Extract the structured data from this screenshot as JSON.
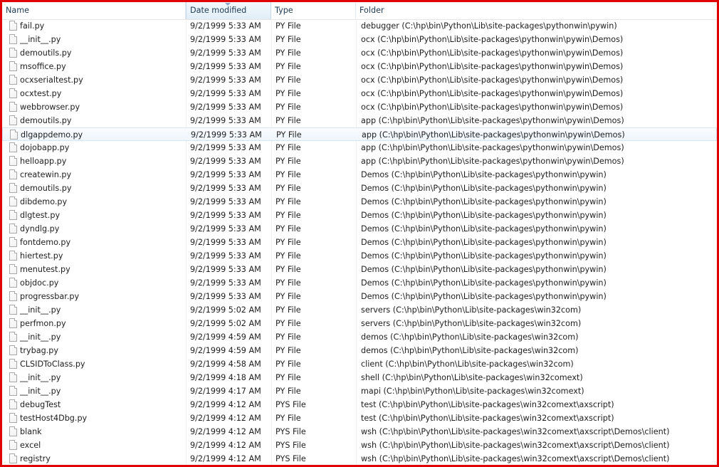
{
  "columns": {
    "name": "Name",
    "date": "Date modified",
    "type": "Type",
    "folder": "Folder"
  },
  "sorted_column": "date",
  "hover_row_index": 8,
  "files": [
    {
      "name": "fail.py",
      "date": "9/2/1999 5:33 AM",
      "type": "PY File",
      "folder": "debugger (C:\\hp\\bin\\Python\\Lib\\site-packages\\pythonwin\\pywin)"
    },
    {
      "name": "__init__.py",
      "date": "9/2/1999 5:33 AM",
      "type": "PY File",
      "folder": "ocx (C:\\hp\\bin\\Python\\Lib\\site-packages\\pythonwin\\pywin\\Demos)"
    },
    {
      "name": "demoutils.py",
      "date": "9/2/1999 5:33 AM",
      "type": "PY File",
      "folder": "ocx (C:\\hp\\bin\\Python\\Lib\\site-packages\\pythonwin\\pywin\\Demos)"
    },
    {
      "name": "msoffice.py",
      "date": "9/2/1999 5:33 AM",
      "type": "PY File",
      "folder": "ocx (C:\\hp\\bin\\Python\\Lib\\site-packages\\pythonwin\\pywin\\Demos)"
    },
    {
      "name": "ocxserialtest.py",
      "date": "9/2/1999 5:33 AM",
      "type": "PY File",
      "folder": "ocx (C:\\hp\\bin\\Python\\Lib\\site-packages\\pythonwin\\pywin\\Demos)"
    },
    {
      "name": "ocxtest.py",
      "date": "9/2/1999 5:33 AM",
      "type": "PY File",
      "folder": "ocx (C:\\hp\\bin\\Python\\Lib\\site-packages\\pythonwin\\pywin\\Demos)"
    },
    {
      "name": "webbrowser.py",
      "date": "9/2/1999 5:33 AM",
      "type": "PY File",
      "folder": "ocx (C:\\hp\\bin\\Python\\Lib\\site-packages\\pythonwin\\pywin\\Demos)"
    },
    {
      "name": "demoutils.py",
      "date": "9/2/1999 5:33 AM",
      "type": "PY File",
      "folder": "app (C:\\hp\\bin\\Python\\Lib\\site-packages\\pythonwin\\pywin\\Demos)"
    },
    {
      "name": "dlgappdemo.py",
      "date": "9/2/1999 5:33 AM",
      "type": "PY File",
      "folder": "app (C:\\hp\\bin\\Python\\Lib\\site-packages\\pythonwin\\pywin\\Demos)"
    },
    {
      "name": "dojobapp.py",
      "date": "9/2/1999 5:33 AM",
      "type": "PY File",
      "folder": "app (C:\\hp\\bin\\Python\\Lib\\site-packages\\pythonwin\\pywin\\Demos)"
    },
    {
      "name": "helloapp.py",
      "date": "9/2/1999 5:33 AM",
      "type": "PY File",
      "folder": "app (C:\\hp\\bin\\Python\\Lib\\site-packages\\pythonwin\\pywin\\Demos)"
    },
    {
      "name": "createwin.py",
      "date": "9/2/1999 5:33 AM",
      "type": "PY File",
      "folder": "Demos (C:\\hp\\bin\\Python\\Lib\\site-packages\\pythonwin\\pywin)"
    },
    {
      "name": "demoutils.py",
      "date": "9/2/1999 5:33 AM",
      "type": "PY File",
      "folder": "Demos (C:\\hp\\bin\\Python\\Lib\\site-packages\\pythonwin\\pywin)"
    },
    {
      "name": "dibdemo.py",
      "date": "9/2/1999 5:33 AM",
      "type": "PY File",
      "folder": "Demos (C:\\hp\\bin\\Python\\Lib\\site-packages\\pythonwin\\pywin)"
    },
    {
      "name": "dlgtest.py",
      "date": "9/2/1999 5:33 AM",
      "type": "PY File",
      "folder": "Demos (C:\\hp\\bin\\Python\\Lib\\site-packages\\pythonwin\\pywin)"
    },
    {
      "name": "dyndlg.py",
      "date": "9/2/1999 5:33 AM",
      "type": "PY File",
      "folder": "Demos (C:\\hp\\bin\\Python\\Lib\\site-packages\\pythonwin\\pywin)"
    },
    {
      "name": "fontdemo.py",
      "date": "9/2/1999 5:33 AM",
      "type": "PY File",
      "folder": "Demos (C:\\hp\\bin\\Python\\Lib\\site-packages\\pythonwin\\pywin)"
    },
    {
      "name": "hiertest.py",
      "date": "9/2/1999 5:33 AM",
      "type": "PY File",
      "folder": "Demos (C:\\hp\\bin\\Python\\Lib\\site-packages\\pythonwin\\pywin)"
    },
    {
      "name": "menutest.py",
      "date": "9/2/1999 5:33 AM",
      "type": "PY File",
      "folder": "Demos (C:\\hp\\bin\\Python\\Lib\\site-packages\\pythonwin\\pywin)"
    },
    {
      "name": "objdoc.py",
      "date": "9/2/1999 5:33 AM",
      "type": "PY File",
      "folder": "Demos (C:\\hp\\bin\\Python\\Lib\\site-packages\\pythonwin\\pywin)"
    },
    {
      "name": "progressbar.py",
      "date": "9/2/1999 5:33 AM",
      "type": "PY File",
      "folder": "Demos (C:\\hp\\bin\\Python\\Lib\\site-packages\\pythonwin\\pywin)"
    },
    {
      "name": "__init__.py",
      "date": "9/2/1999 5:02 AM",
      "type": "PY File",
      "folder": "servers (C:\\hp\\bin\\Python\\Lib\\site-packages\\win32com)"
    },
    {
      "name": "perfmon.py",
      "date": "9/2/1999 5:02 AM",
      "type": "PY File",
      "folder": "servers (C:\\hp\\bin\\Python\\Lib\\site-packages\\win32com)"
    },
    {
      "name": "__init__.py",
      "date": "9/2/1999 4:59 AM",
      "type": "PY File",
      "folder": "demos (C:\\hp\\bin\\Python\\Lib\\site-packages\\win32com)"
    },
    {
      "name": "trybag.py",
      "date": "9/2/1999 4:59 AM",
      "type": "PY File",
      "folder": "demos (C:\\hp\\bin\\Python\\Lib\\site-packages\\win32com)"
    },
    {
      "name": "CLSIDToClass.py",
      "date": "9/2/1999 4:58 AM",
      "type": "PY File",
      "folder": "client (C:\\hp\\bin\\Python\\Lib\\site-packages\\win32com)"
    },
    {
      "name": "__init__.py",
      "date": "9/2/1999 4:18 AM",
      "type": "PY File",
      "folder": "shell (C:\\hp\\bin\\Python\\Lib\\site-packages\\win32comext)"
    },
    {
      "name": "__init__.py",
      "date": "9/2/1999 4:17 AM",
      "type": "PY File",
      "folder": "mapi (C:\\hp\\bin\\Python\\Lib\\site-packages\\win32comext)"
    },
    {
      "name": "debugTest",
      "date": "9/2/1999 4:12 AM",
      "type": "PYS File",
      "folder": "test (C:\\hp\\bin\\Python\\Lib\\site-packages\\win32comext\\axscript)"
    },
    {
      "name": "testHost4Dbg.py",
      "date": "9/2/1999 4:12 AM",
      "type": "PY File",
      "folder": "test (C:\\hp\\bin\\Python\\Lib\\site-packages\\win32comext\\axscript)"
    },
    {
      "name": "blank",
      "date": "9/2/1999 4:12 AM",
      "type": "PYS File",
      "folder": "wsh (C:\\hp\\bin\\Python\\Lib\\site-packages\\win32comext\\axscript\\Demos\\client)"
    },
    {
      "name": "excel",
      "date": "9/2/1999 4:12 AM",
      "type": "PYS File",
      "folder": "wsh (C:\\hp\\bin\\Python\\Lib\\site-packages\\win32comext\\axscript\\Demos\\client)"
    },
    {
      "name": "registry",
      "date": "9/2/1999 4:12 AM",
      "type": "PYS File",
      "folder": "wsh (C:\\hp\\bin\\Python\\Lib\\site-packages\\win32comext\\axscript\\Demos\\client)"
    }
  ]
}
